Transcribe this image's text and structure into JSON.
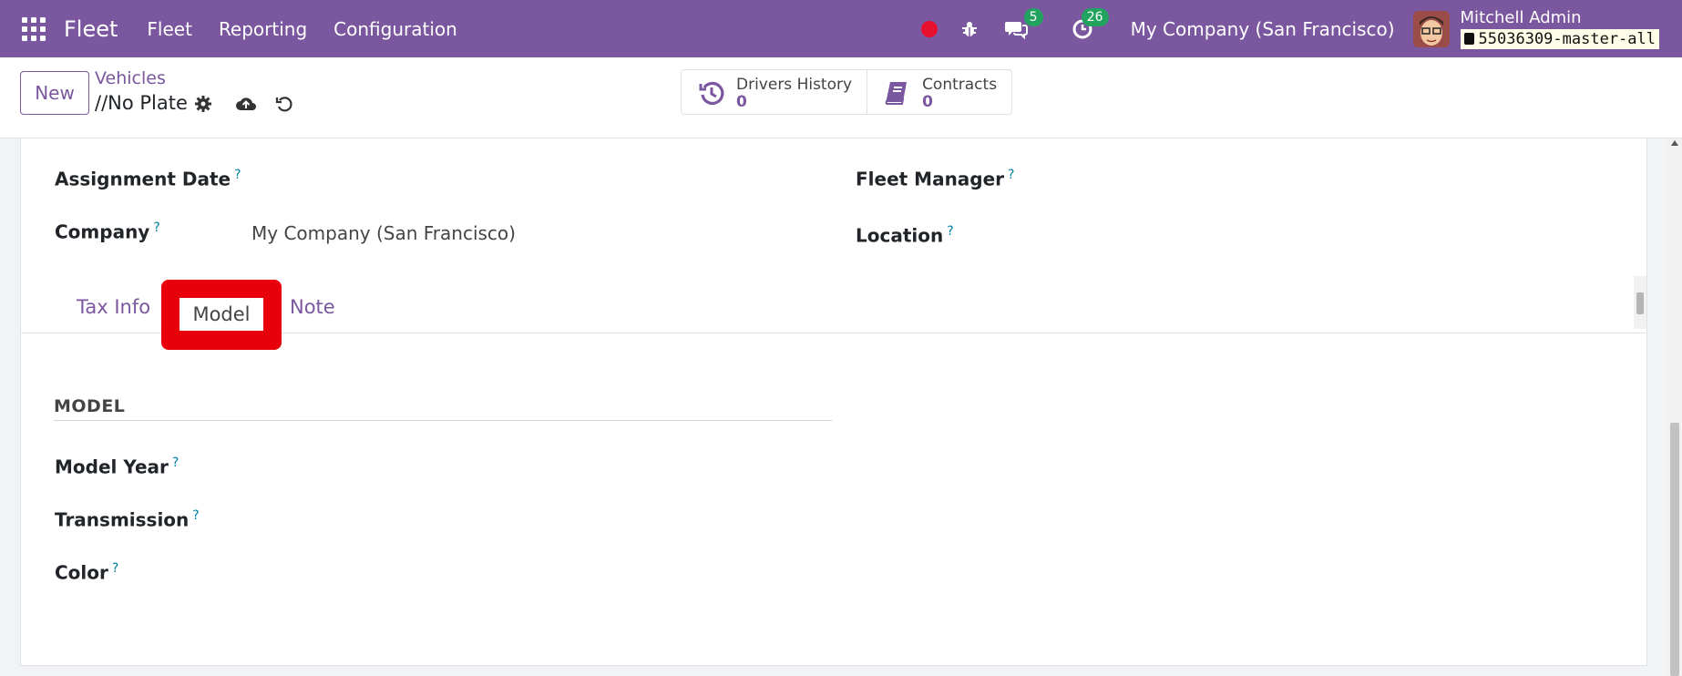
{
  "navbar": {
    "app_name": "Fleet",
    "menus": [
      "Fleet",
      "Reporting",
      "Configuration"
    ],
    "messages_count": "5",
    "activities_count": "26",
    "company": "My Company (San Francisco)",
    "user_name": "Mitchell Admin",
    "database": "55036309-master-all"
  },
  "control_panel": {
    "new_label": "New",
    "breadcrumb": "Vehicles",
    "record_name": "//No Plate",
    "smart_buttons": [
      {
        "label": "Drivers History",
        "value": "0",
        "icon": "history-icon"
      },
      {
        "label": "Contracts",
        "value": "0",
        "icon": "book-icon"
      }
    ]
  },
  "form": {
    "assignment_date_label": "Assignment Date",
    "fleet_manager_label": "Fleet Manager",
    "company_label": "Company",
    "company_value": "My Company (San Francisco)",
    "location_label": "Location",
    "help_mark": "?",
    "tabs": [
      "Tax Info",
      "Model",
      "Note"
    ],
    "active_tab": "Model",
    "section_title": "MODEL",
    "model_year_label": "Model Year",
    "transmission_label": "Transmission",
    "color_label": "Color"
  },
  "colors": {
    "brand": "#7a579f",
    "highlight": "#e8000b",
    "badge": "#21a35f",
    "help": "#0180a5"
  }
}
